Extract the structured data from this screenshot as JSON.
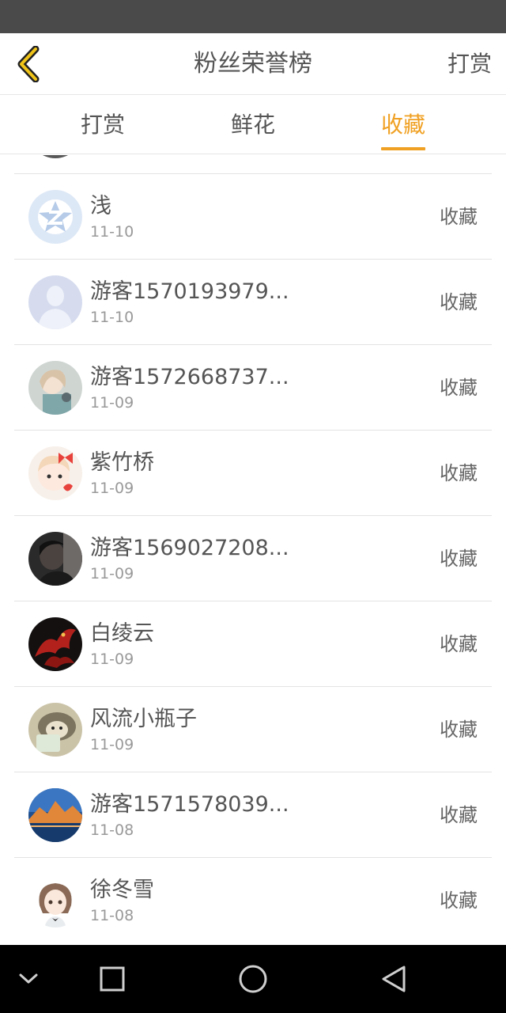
{
  "header": {
    "title": "粉丝荣誉榜",
    "action": "打赏"
  },
  "tabs": [
    {
      "label": "打赏",
      "active": false
    },
    {
      "label": "鲜花",
      "active": false
    },
    {
      "label": "收藏",
      "active": true
    }
  ],
  "colors": {
    "accent": "#f0a022",
    "status_bar": "#4a4a4a",
    "nav_bar": "#000000"
  },
  "list": [
    {
      "name": "浅",
      "date": "11-10",
      "action": "收藏",
      "avatar": "qq-default-avatar"
    },
    {
      "name": "游客1570193979...",
      "date": "11-10",
      "action": "收藏",
      "avatar": "default-person-avatar"
    },
    {
      "name": "游客1572668737...",
      "date": "11-09",
      "action": "收藏",
      "avatar": "anime-girl-avatar"
    },
    {
      "name": "紫竹桥",
      "date": "11-09",
      "action": "收藏",
      "avatar": "cartoon-girl-bow-avatar"
    },
    {
      "name": "游客1569027208...",
      "date": "11-09",
      "action": "收藏",
      "avatar": "dark-photo-avatar"
    },
    {
      "name": "白绫云",
      "date": "11-09",
      "action": "收藏",
      "avatar": "red-dragon-avatar"
    },
    {
      "name": "风流小瓶子",
      "date": "11-09",
      "action": "收藏",
      "avatar": "hedgehog-avatar"
    },
    {
      "name": "游客1571578039...",
      "date": "11-08",
      "action": "收藏",
      "avatar": "landscape-avatar"
    },
    {
      "name": "徐冬雪",
      "date": "11-08",
      "action": "收藏",
      "avatar": "anime-girl-brown-hair-avatar"
    }
  ],
  "nav": {
    "icons": [
      "chevron-down-icon",
      "recent-apps-icon",
      "home-icon",
      "back-triangle-icon"
    ]
  }
}
